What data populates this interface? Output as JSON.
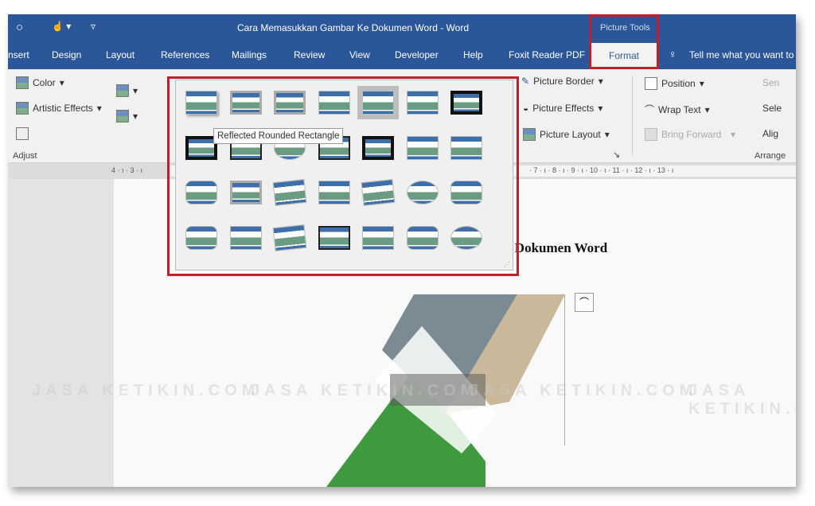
{
  "titlebar": {
    "title": "Cara Memasukkan Gambar Ke Dokumen Word  -  Word",
    "context_group": "Picture Tools"
  },
  "tabs": [
    "nsert",
    "Design",
    "Layout",
    "References",
    "Mailings",
    "Review",
    "View",
    "Developer",
    "Help",
    "Foxit Reader PDF"
  ],
  "active_tab": "Format",
  "tell_me": "Tell me what you want to",
  "ribbon": {
    "adjust": {
      "color": "Color",
      "artistic": "Artistic Effects",
      "group": "Adjust"
    },
    "styles": {
      "border": "Picture Border",
      "effects": "Picture Effects",
      "layout": "Picture Layout"
    },
    "arrange": {
      "position": "Position",
      "wrap": "Wrap Text",
      "forward": "Bring Forward",
      "send": "Sen",
      "select": "Sele",
      "align": "Alig",
      "group": "Arrange"
    }
  },
  "ruler": {
    "left": "4 · ı · 3 · ı",
    "right": "· 7 · ı · 8 · ı · 9 · ı · 10 · ı · 11 · ı · 12 · ı · 13 · ı"
  },
  "gallery": {
    "tooltip": "Reflected Rounded Rectangle",
    "hovered_index": 4,
    "styles": [
      "sh",
      "fr",
      "fr",
      "",
      "hl",
      "",
      "b1",
      "b1",
      "b2",
      "ov",
      "b2",
      "b1",
      "",
      "",
      "rr",
      "fr",
      "rot",
      "",
      "rot",
      "ov",
      "rr",
      "rr",
      "",
      "rot",
      "b2",
      "",
      "rr",
      "ov"
    ]
  },
  "document": {
    "heading": "e Dokumen Word"
  },
  "watermark": "JASA KETIKIN.COM",
  "colors": {
    "word_blue": "#2b579a",
    "highlight_red": "#c0202a"
  }
}
